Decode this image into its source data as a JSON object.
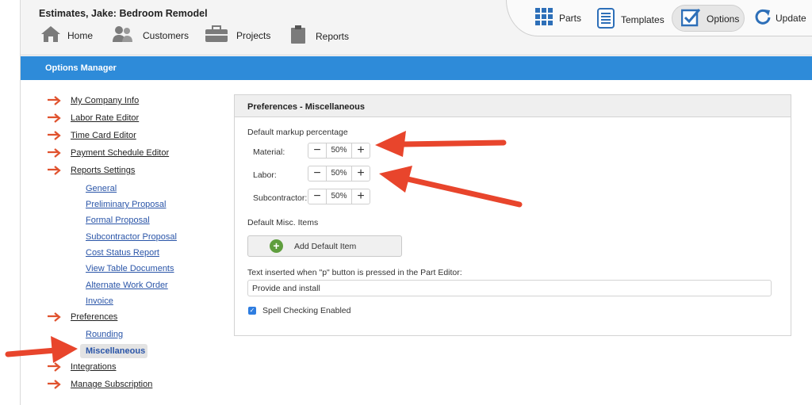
{
  "window_title": "Estimates, Jake: Bedroom Remodel",
  "top_nav": [
    {
      "label": "Parts",
      "icon": "grid-icon"
    },
    {
      "label": "Templates",
      "icon": "document-list-icon"
    },
    {
      "label": "Options",
      "icon": "checkbox-icon",
      "active": true
    },
    {
      "label": "Update",
      "icon": "refresh-icon"
    }
  ],
  "main_nav": [
    {
      "label": "Home",
      "icon": "house-icon"
    },
    {
      "label": "Customers",
      "icon": "people-icon"
    },
    {
      "label": "Projects",
      "icon": "briefcase-icon"
    },
    {
      "label": "Reports",
      "icon": "clipboard-icon"
    }
  ],
  "section_bar": "Options Manager",
  "sidebar": {
    "items": [
      {
        "label": "My Company Info"
      },
      {
        "label": "Labor Rate Editor"
      },
      {
        "label": "Time Card Editor"
      },
      {
        "label": "Payment Schedule Editor"
      },
      {
        "label": "Reports Settings"
      },
      {
        "label": "Preferences"
      },
      {
        "label": "Integrations"
      },
      {
        "label": "Manage Subscription"
      }
    ],
    "report_subitems": [
      {
        "label": "General"
      },
      {
        "label": "Preliminary Proposal"
      },
      {
        "label": "Formal Proposal"
      },
      {
        "label": "Subcontractor Proposal"
      },
      {
        "label": "Cost Status Report"
      },
      {
        "label": "View Table Documents"
      },
      {
        "label": "Alternate Work Order"
      },
      {
        "label": "Invoice"
      }
    ],
    "preference_subitems": [
      {
        "label": "Rounding"
      },
      {
        "label": "Miscellaneous",
        "active": true
      }
    ]
  },
  "panel": {
    "title": "Preferences - Miscellaneous",
    "markup_heading": "Default markup percentage",
    "markup_rows": [
      {
        "label": "Material:",
        "value": "50%"
      },
      {
        "label": "Labor:",
        "value": "50%"
      },
      {
        "label": "Subcontractor:",
        "value": "50%"
      }
    ],
    "stepper_minus": "−",
    "stepper_plus": "+",
    "misc_heading": "Default Misc. Items",
    "add_button": "Add Default Item",
    "text_label": "Text inserted when \"p\" button is pressed in the Part Editor:",
    "text_value": "Provide and install",
    "spellcheck_label": "Spell Checking Enabled",
    "spellcheck_checked": true
  },
  "colors": {
    "accent_blue": "#2e8bd9",
    "annotation_arrow": "#e8452c",
    "menu_arrow": "#e0522e",
    "add_green": "#5f9e3e"
  }
}
